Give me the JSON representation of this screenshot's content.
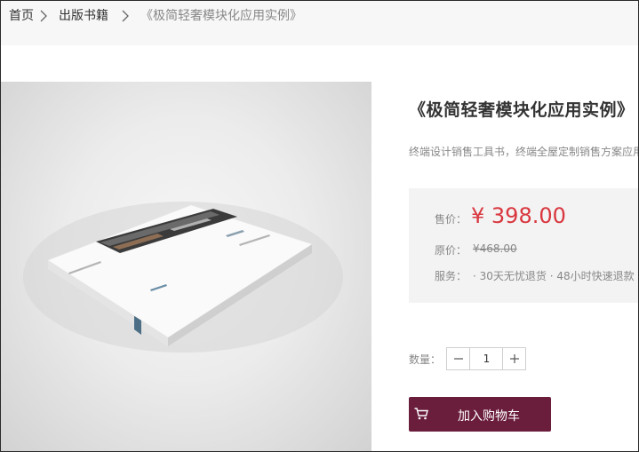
{
  "breadcrumb": {
    "home": "首页",
    "category": "出版书籍",
    "current": "《极简轻奢模块化应用实例》"
  },
  "product": {
    "title": "《极简轻奢模块化应用实例》",
    "subtitle": "终端设计销售工具书，终端全屋定制销售方案应用",
    "price_label": "售价：",
    "price": "¥ 398.00",
    "original_label": "原价：",
    "original_price": "¥468.00",
    "service_label": "服务：",
    "service_text": "· 30天无忧退货 · 48小时快速退款 ·"
  },
  "purchase": {
    "quantity_label": "数量：",
    "quantity_value": "1",
    "add_to_cart": "加入购物车"
  },
  "icons": {
    "separator": "chevron-right-icon",
    "minus": "minus-icon",
    "plus": "plus-icon",
    "cart": "cart-icon"
  },
  "colors": {
    "price_red": "#d9363e",
    "cart_button": "#6b1d3c",
    "price_box_bg": "#f3f3f3",
    "breadcrumb_bg": "#f7f7f7"
  }
}
